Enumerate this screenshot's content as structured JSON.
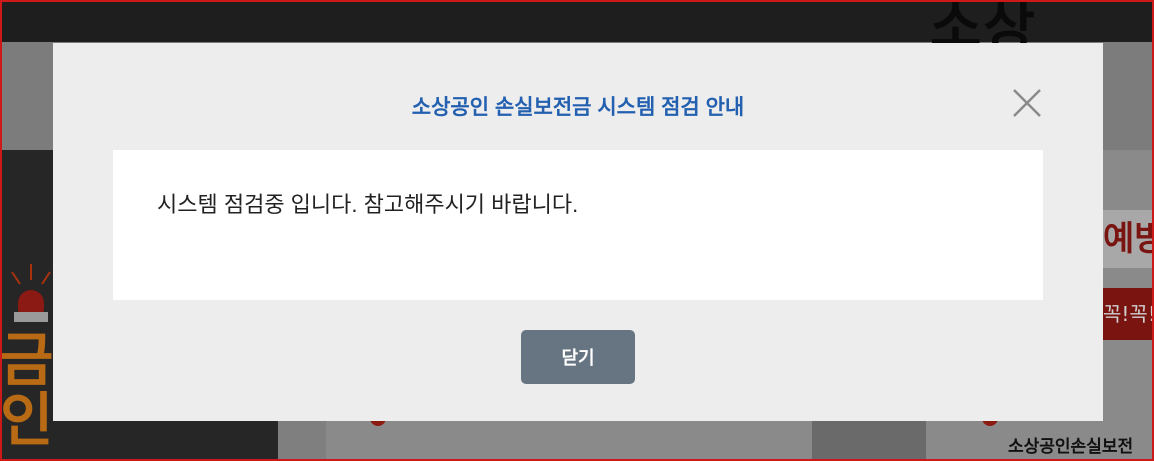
{
  "background": {
    "headline_fragment": "소상",
    "left_text_fragment": "금\n인",
    "right_label_fragment": "예방",
    "right_box_fragment": "꼭!꼭!",
    "footer_text": "소상공인손실보전"
  },
  "modal": {
    "title": "소상공인 손실보전금 시스템 점검 안내",
    "message": "시스템 점검중 입니다. 참고해주시기 바랍니다.",
    "close_button_label": "닫기",
    "close_icon": "close-icon"
  },
  "colors": {
    "title": "#2360b0",
    "button": "#677582",
    "modal_bg": "#ededed",
    "frame": "#cc1a1a"
  }
}
